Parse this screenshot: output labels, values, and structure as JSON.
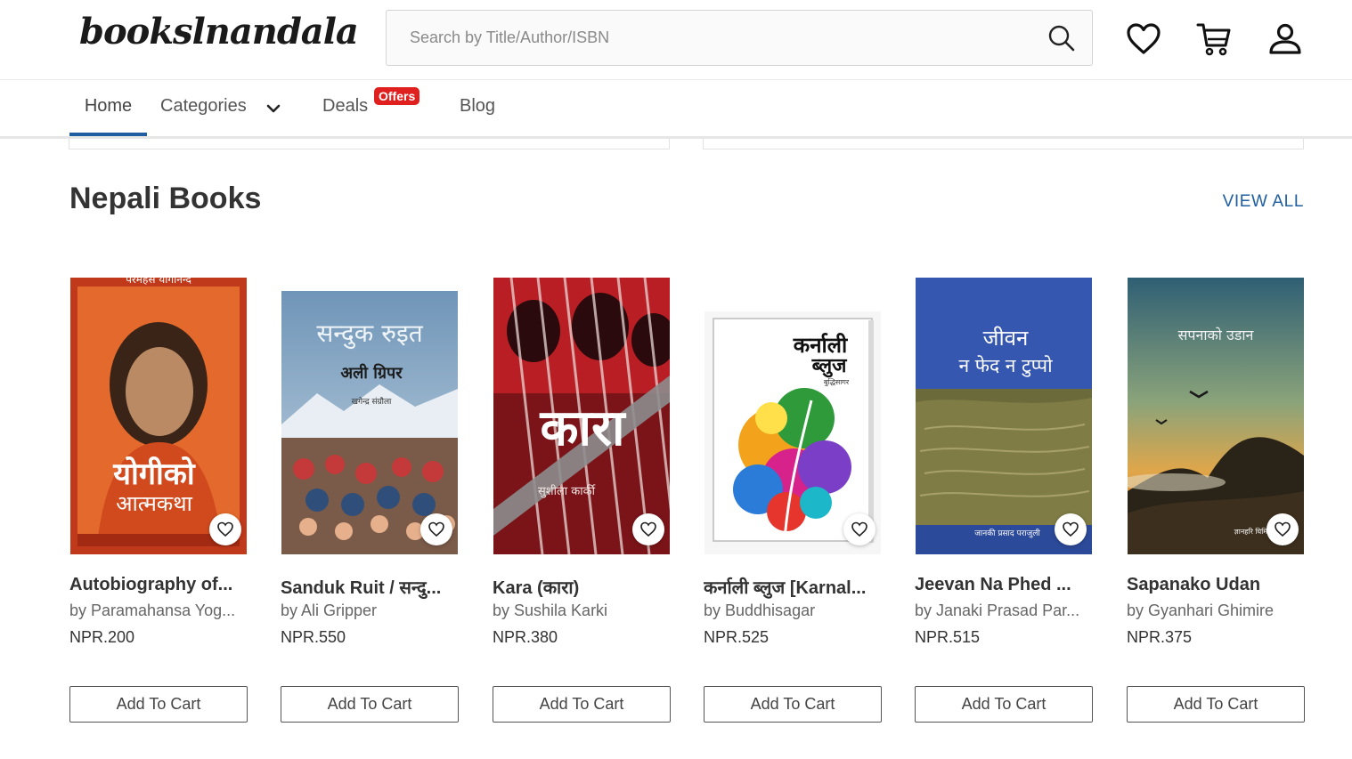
{
  "header": {
    "logo": "bookslnandala",
    "search_placeholder": "Search by Title/Author/ISBN",
    "icons": [
      "search-icon",
      "heart-icon",
      "cart-icon",
      "user-icon"
    ]
  },
  "nav": {
    "home": "Home",
    "categories": "Categories",
    "deals": "Deals",
    "offers_badge": "Offers",
    "blog": "Blog"
  },
  "section": {
    "title": "Nepali Books",
    "view_all": "VIEW ALL"
  },
  "products": [
    {
      "title": "Autobiography of...",
      "author": "by Paramahansa Yog...",
      "price": "NPR.200",
      "cta": "Add To Cart",
      "cover_title": "योगीको",
      "cover_sub": "आत्मकथा",
      "cover_top": "परमहंस योगानन्द"
    },
    {
      "title": "Sanduk Ruit / सन्दु...",
      "author": "by Ali Gripper",
      "price": "NPR.550",
      "cta": "Add To Cart",
      "cover_title": "सन्दुक रुइत",
      "cover_sub": "अली ग्रिपर",
      "cover_top": "खगेन्द्र संग्रौला"
    },
    {
      "title": "Kara (कारा)",
      "author": "by Sushila Karki",
      "price": "NPR.380",
      "cta": "Add To Cart",
      "cover_title": "कारा",
      "cover_sub": "सुशीला कार्की"
    },
    {
      "title": "कर्नाली ब्लुज [Karnal...",
      "author": "by Buddhisagar",
      "price": "NPR.525",
      "cta": "Add To Cart",
      "cover_title": "कर्नाली",
      "cover_sub": "ब्लुज",
      "cover_top": "बुद्धिसागर"
    },
    {
      "title": "Jeevan Na Phed ...",
      "author": "by Janaki Prasad Par...",
      "price": "NPR.515",
      "cta": "Add To Cart",
      "cover_title": "जीवन",
      "cover_sub": "न फेद न टुप्पो",
      "cover_top": "जानकी प्रसाद पराजुली"
    },
    {
      "title": "Sapanako Udan",
      "author": "by Gyanhari Ghimire",
      "price": "NPR.375",
      "cta": "Add To Cart",
      "cover_title": "सपनाको उडान",
      "cover_sub": "ज्ञानहरि घिमिरे"
    }
  ],
  "colors": {
    "accent": "#1f5fa0",
    "badge": "#e0201f"
  }
}
